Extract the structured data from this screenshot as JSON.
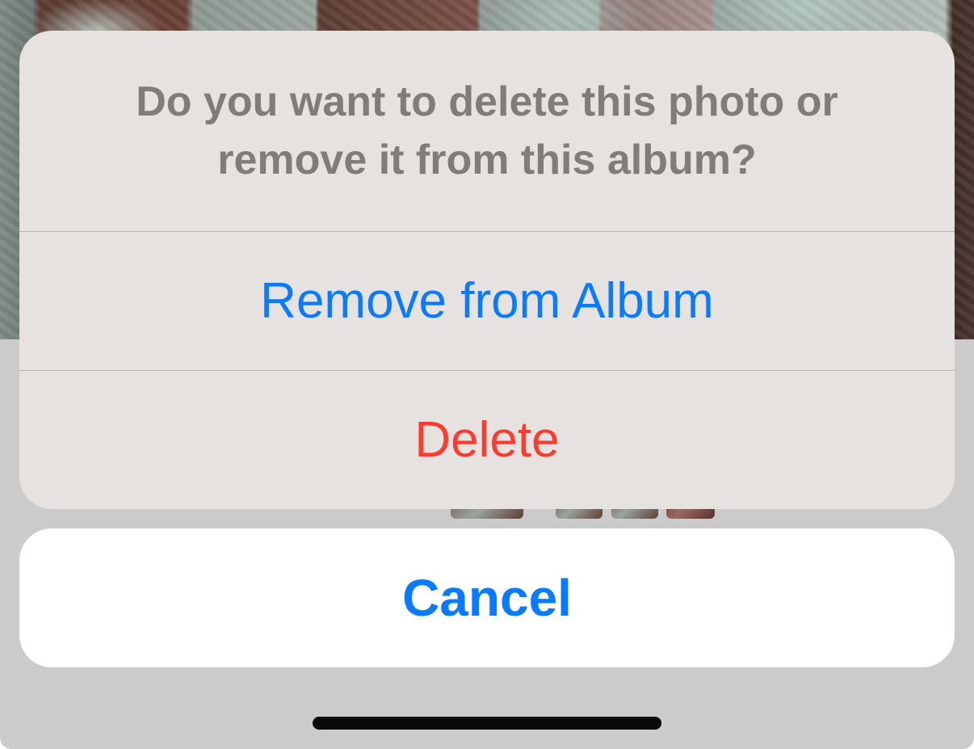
{
  "sheet": {
    "message": "Do you want to delete this photo or remove it from this album?",
    "actions": [
      {
        "label": "Remove from Album",
        "color": "#0a7aff"
      },
      {
        "label": "Delete",
        "color": "#ff3b30"
      }
    ]
  },
  "cancel": {
    "label": "Cancel",
    "color": "#0a7aff"
  },
  "colors": {
    "sheet_background": "#e5e2df",
    "dim_background": "#cbcbcb",
    "message_text": "#7f7c79"
  }
}
